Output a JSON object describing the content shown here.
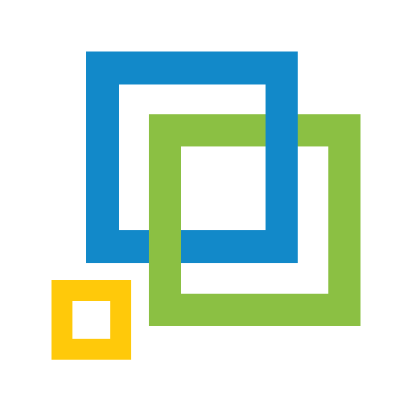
{
  "icon": {
    "name": "overlapping-squares-logo",
    "colors": {
      "background": "#ffffff",
      "blue": "#1289C9",
      "green": "#8BC043",
      "yellow": "#FFC90A"
    }
  }
}
